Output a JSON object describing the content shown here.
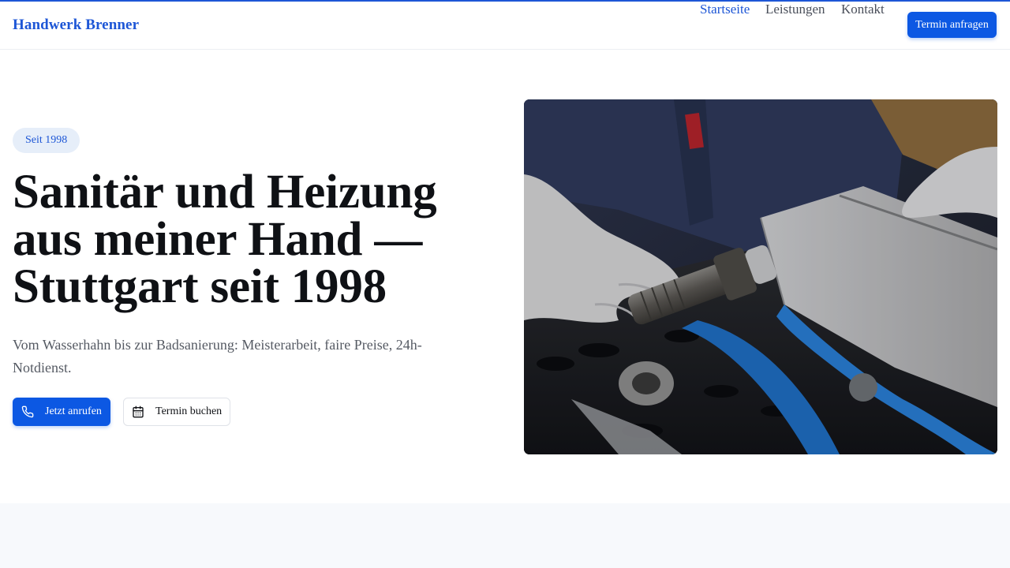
{
  "brand": "Handwerk Brenner",
  "nav": {
    "links": [
      {
        "label": "Startseite",
        "active": true
      },
      {
        "label": "Leistungen",
        "active": false
      },
      {
        "label": "Kontakt",
        "active": false
      }
    ],
    "cta_label": "Termin anfragen"
  },
  "hero": {
    "badge": "Seit 1998",
    "title_lines": [
      "Sanitär und Heizung",
      "aus meiner Hand —",
      "Stuttgart seit 1998"
    ],
    "subtitle": "Vom Wasserhahn bis zur Badsanierung: Meisterarbeit, faire Preise, 24h-Notdienst.",
    "primary_button": {
      "label": "Jetzt anrufen",
      "icon": "phone-icon"
    },
    "secondary_button": {
      "label": "Termin buchen",
      "icon": "calendar-icon"
    }
  },
  "colors": {
    "accent": "#1d56d6",
    "button": "#0c58e3",
    "badge_bg": "#e6eef9",
    "lower_band_bg": "#f7f9fc"
  }
}
